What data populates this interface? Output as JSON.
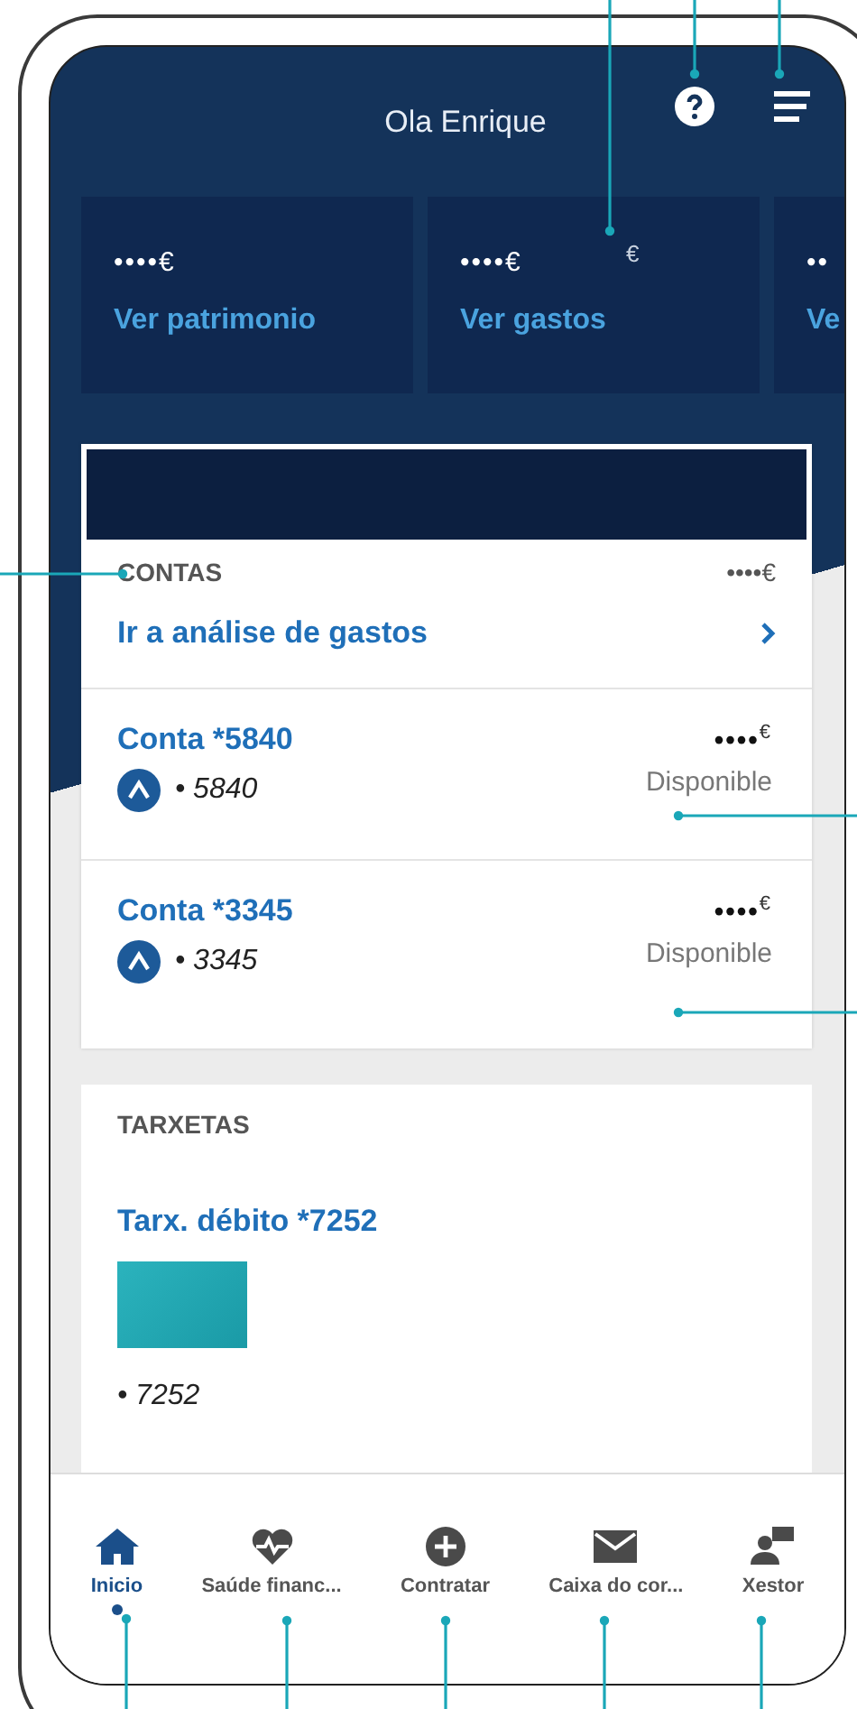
{
  "header": {
    "greeting": "Ola Enrique"
  },
  "summary_cards": [
    {
      "amount": "••••€",
      "label": "Ver patrimonio"
    },
    {
      "amount": "••••€",
      "label": "Ver gastos",
      "note": "€"
    },
    {
      "amount": "••",
      "label": "Ve"
    }
  ],
  "accounts_panel": {
    "title": "CONTAS",
    "total": "••••€",
    "link": "Ir a análise de gastos",
    "accounts": [
      {
        "name": "Conta *5840",
        "number": "• 5840",
        "amount": "••••",
        "currency": "€",
        "status": "Disponible"
      },
      {
        "name": "Conta *3345",
        "number": "• 3345",
        "amount": "••••",
        "currency": "€",
        "status": "Disponible"
      }
    ]
  },
  "cards_panel": {
    "title": "TARXETAS",
    "card_name": "Tarx. débito *7252",
    "number": "• 7252"
  },
  "bottom_nav": [
    {
      "kind": "home",
      "label": "Inicio",
      "selected": true
    },
    {
      "kind": "health",
      "label": "Saúde financ...",
      "selected": false
    },
    {
      "kind": "add",
      "label": "Contratar",
      "selected": false
    },
    {
      "kind": "mail",
      "label": "Caixa do cor...",
      "selected": false
    },
    {
      "kind": "advisor",
      "label": "Xestor",
      "selected": false
    }
  ]
}
